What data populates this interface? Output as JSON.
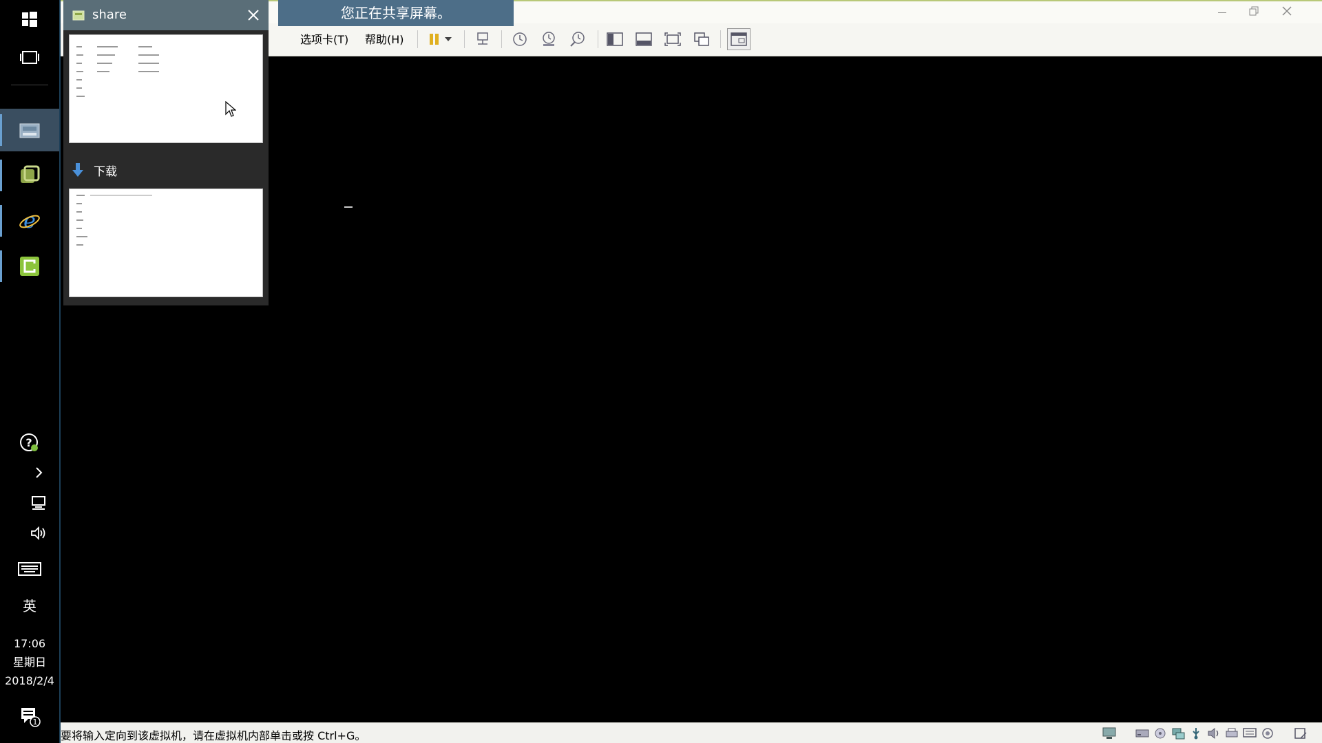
{
  "taskbar": {
    "clock_time": "17:06",
    "clock_weekday": "星期日",
    "clock_date": "2018/2/4",
    "ime_label": "英",
    "notification_count": "1"
  },
  "window": {
    "share_banner": "您正在共享屏幕。",
    "menus": {
      "tabs": "选项卡(T)",
      "help": "帮助(H)"
    },
    "status_message": "要将输入定向到该虚拟机，请在虚拟机内部单击或按 Ctrl+G。"
  },
  "preview": {
    "group_title": "share",
    "download_label": "下载"
  },
  "colors": {
    "taskbar_bg": "#000000",
    "active_app_bg": "#3a4e60",
    "banner_bg": "#4d6e88",
    "preview_header": "#5a6e78"
  }
}
